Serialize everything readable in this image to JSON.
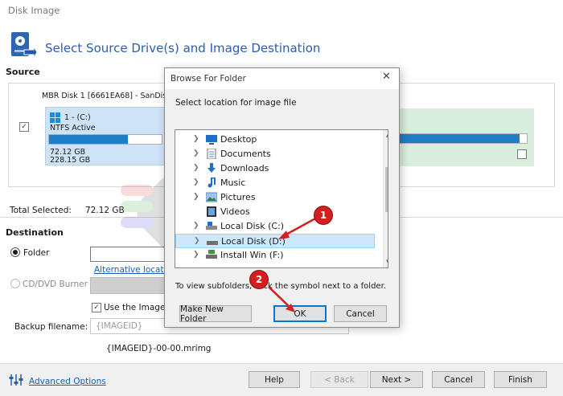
{
  "window": {
    "title": "Disk Image"
  },
  "header": {
    "title": "Select Source Drive(s) and Image Destination"
  },
  "source": {
    "label": "Source",
    "disk_label": "MBR Disk 1 [6661EA68] - SanDisk SD6",
    "partition": {
      "name": "1 - (C:)",
      "fs": "NTFS Active",
      "used": "72.12 GB",
      "total": "228.15 GB",
      "used_fraction": 0.7
    },
    "disk2_fill_fraction": 0.94,
    "total_selected_label": "Total Selected:",
    "total_selected_value": "72.12 GB"
  },
  "destination": {
    "label": "Destination",
    "folder_option": "Folder",
    "alt_locations_link": "Alternative locatio",
    "cd_option": "CD/DVD Burner",
    "use_imageid_label": "Use the Image ID",
    "backup_filename_label": "Backup filename:",
    "backup_filename_placeholder": "{IMAGEID}",
    "filename_preview": "{IMAGEID}-00-00.mrimg"
  },
  "dialog": {
    "title": "Browse For Folder",
    "prompt": "Select location for image file",
    "tree": [
      {
        "label": "Desktop",
        "icon": "desktop-icon"
      },
      {
        "label": "Documents",
        "icon": "documents-icon"
      },
      {
        "label": "Downloads",
        "icon": "downloads-icon"
      },
      {
        "label": "Music",
        "icon": "music-icon"
      },
      {
        "label": "Pictures",
        "icon": "pictures-icon"
      },
      {
        "label": "Videos",
        "icon": "videos-icon"
      },
      {
        "label": "Local Disk (C:)",
        "icon": "drive-icon"
      },
      {
        "label": "Local Disk (D:)",
        "icon": "drive-icon",
        "selected": true
      },
      {
        "label": "Install Win (F:)",
        "icon": "install-drive-icon"
      }
    ],
    "hint": "To view subfolders, click the symbol next to a folder.",
    "new_folder": "Make New Folder",
    "ok": "OK",
    "cancel": "Cancel"
  },
  "annotations": {
    "step1": "1",
    "step2": "2"
  },
  "footer": {
    "advanced": "Advanced Options",
    "help": "Help",
    "back": "< Back",
    "next": "Next >",
    "cancel": "Cancel",
    "finish": "Finish"
  },
  "colors": {
    "accent": "#2a5db0",
    "partition_fill": "#1e7ec8",
    "badge": "#d31f1f"
  }
}
